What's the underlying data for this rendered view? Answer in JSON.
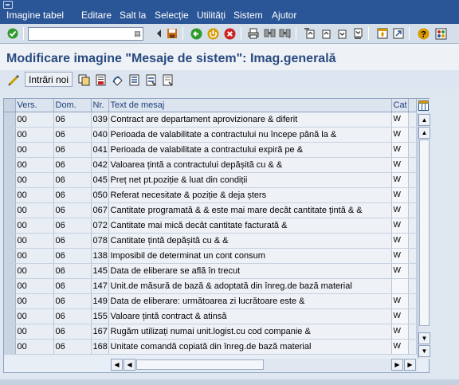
{
  "menu": {
    "items": [
      "Imagine tabel",
      "Editare",
      "Salt la",
      "Selecție",
      "Utilități",
      "Sistem",
      "Ajutor"
    ]
  },
  "command_field": {
    "value": ""
  },
  "title": "Modificare imagine \"Mesaje de sistem\": Imag.generală",
  "app_toolbar": {
    "new_entries_label": "Intrări noi"
  },
  "table": {
    "columns": [
      "Vers.",
      "Dom.",
      "Nr.",
      "Text de mesaj",
      "Cat"
    ],
    "rows": [
      {
        "vers": "00",
        "dom": "06",
        "nr": "039",
        "text": "Contract are departament aprovizionare & diferit",
        "cat": "W"
      },
      {
        "vers": "00",
        "dom": "06",
        "nr": "040",
        "text": "Perioada de valabilitate a contractului nu începe până la &",
        "cat": "W"
      },
      {
        "vers": "00",
        "dom": "06",
        "nr": "041",
        "text": "Perioada de valabilitate a contractului expiră pe &",
        "cat": "W"
      },
      {
        "vers": "00",
        "dom": "06",
        "nr": "042",
        "text": "Valoarea țintă a contractului depășită cu & &",
        "cat": "W"
      },
      {
        "vers": "00",
        "dom": "06",
        "nr": "045",
        "text": "Preț net pt.poziție & luat din condiții",
        "cat": "W"
      },
      {
        "vers": "00",
        "dom": "06",
        "nr": "050",
        "text": "Referat necesitate & poziție & deja șters",
        "cat": "W"
      },
      {
        "vers": "00",
        "dom": "06",
        "nr": "067",
        "text": "Cantitate programată & & este mai mare decât cantitate țintă & &",
        "cat": "W"
      },
      {
        "vers": "00",
        "dom": "06",
        "nr": "072",
        "text": "Cantitate mai mică decât cantitate facturată &",
        "cat": "W"
      },
      {
        "vers": "00",
        "dom": "06",
        "nr": "078",
        "text": "Cantitate țintă depășită cu & &",
        "cat": "W"
      },
      {
        "vers": "00",
        "dom": "06",
        "nr": "138",
        "text": "Imposibil de determinat un cont consum",
        "cat": "W"
      },
      {
        "vers": "00",
        "dom": "06",
        "nr": "145",
        "text": "Data de eliberare se află în trecut",
        "cat": "W"
      },
      {
        "vers": "00",
        "dom": "06",
        "nr": "147",
        "text": "Unit.de măsură de bază & adoptată din înreg.de bază material",
        "cat": ""
      },
      {
        "vers": "00",
        "dom": "06",
        "nr": "149",
        "text": "Data de eliberare: următoarea zi lucrătoare este &",
        "cat": "W"
      },
      {
        "vers": "00",
        "dom": "06",
        "nr": "155",
        "text": "Valoare țintă contract & atinsă",
        "cat": "W"
      },
      {
        "vers": "00",
        "dom": "06",
        "nr": "167",
        "text": "Rugăm utilizați numai unit.logist.cu cod companie &",
        "cat": "W"
      },
      {
        "vers": "00",
        "dom": "06",
        "nr": "168",
        "text": "Unitate comandă copiată din înreg.de bază material",
        "cat": "W"
      }
    ]
  },
  "icons": {
    "enter": "check-icon",
    "save": "save-icon",
    "back": "back-icon",
    "exit": "exit-icon",
    "cancel": "cancel-icon",
    "print": "print-icon",
    "find": "find-icon",
    "help": "help-icon",
    "layout": "layout-icon"
  },
  "colors": {
    "menubar": "#2a5596",
    "title": "#2a4a7f",
    "check": "#2e9b2e",
    "back": "#2e9b2e",
    "exit": "#d89a00",
    "cancel": "#cc2222"
  }
}
